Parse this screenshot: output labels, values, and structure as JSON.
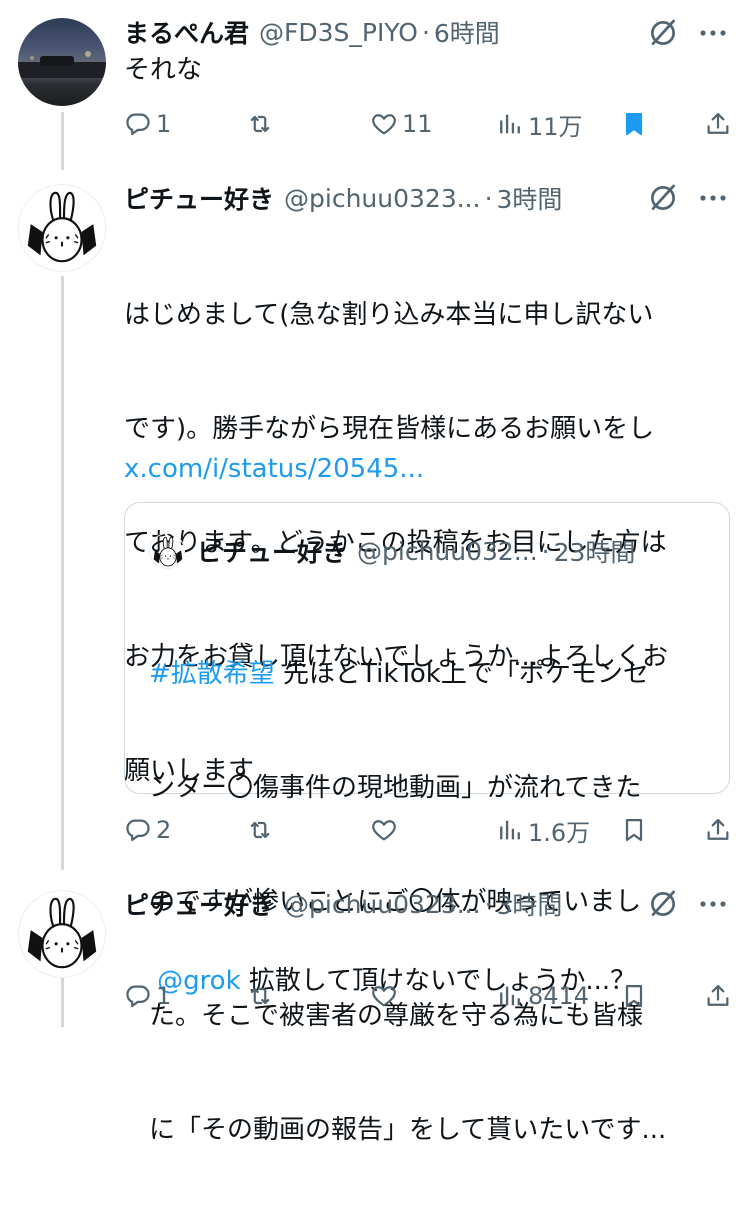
{
  "colors": {
    "text": "#0f1419",
    "muted": "#536471",
    "link": "#1d9bf0",
    "line": "#cfd9de"
  },
  "tweets": [
    {
      "name": "まるぺん君",
      "handle": "@FD3S_PIYO",
      "dot": "·",
      "time": "6時間",
      "text": "それな",
      "avatar_icon": "photo-avatar",
      "actions": {
        "reply": "1",
        "retweet": "",
        "like": "11",
        "views": "11万"
      },
      "bookmarked": true
    },
    {
      "name": "ピチュー好き",
      "handle": "@pichuu0323...",
      "dot": "·",
      "time": "3時間",
      "text_lines": [
        "はじめまして(急な割り込み本当に申し訳ない",
        "です)。勝手ながら現在皆様にあるお願いをし",
        "ております。どうかこの投稿をお目にした方は",
        "お力をお貸し頂けないでしょうか...よろしくお",
        "願いします"
      ],
      "link": "x.com/i/status/20545...",
      "avatar_icon": "rabbit-avatar",
      "quote": {
        "name": "ピチュー好き",
        "handle": "@pichuu032...",
        "dot": "·",
        "time": "23時間",
        "hashtag": "#拡散希望",
        "first_line_rest": " 先ほどTikTok上で「ポケモンセ",
        "lines": [
          "ンター〇傷事件の現地動画」が流れてきた",
          "のですが惨いことにご〇体が映っていまし",
          "た。そこで被害者の尊厳を守る為にも皆様",
          "に「その動画の報告」をして貰いたいです..."
        ]
      },
      "actions": {
        "reply": "2",
        "retweet": "",
        "like": "",
        "views": "1.6万"
      },
      "bookmarked": false
    },
    {
      "name": "ピチュー好き",
      "handle": "@pichuu0323...",
      "dot": "·",
      "time": "3時間",
      "mention": "@grok",
      "text": " 拡散して頂けないでしょうか...？",
      "avatar_icon": "rabbit-avatar",
      "actions": {
        "reply": "1",
        "retweet": "",
        "like": "",
        "views": "8414"
      },
      "bookmarked": false
    }
  ]
}
